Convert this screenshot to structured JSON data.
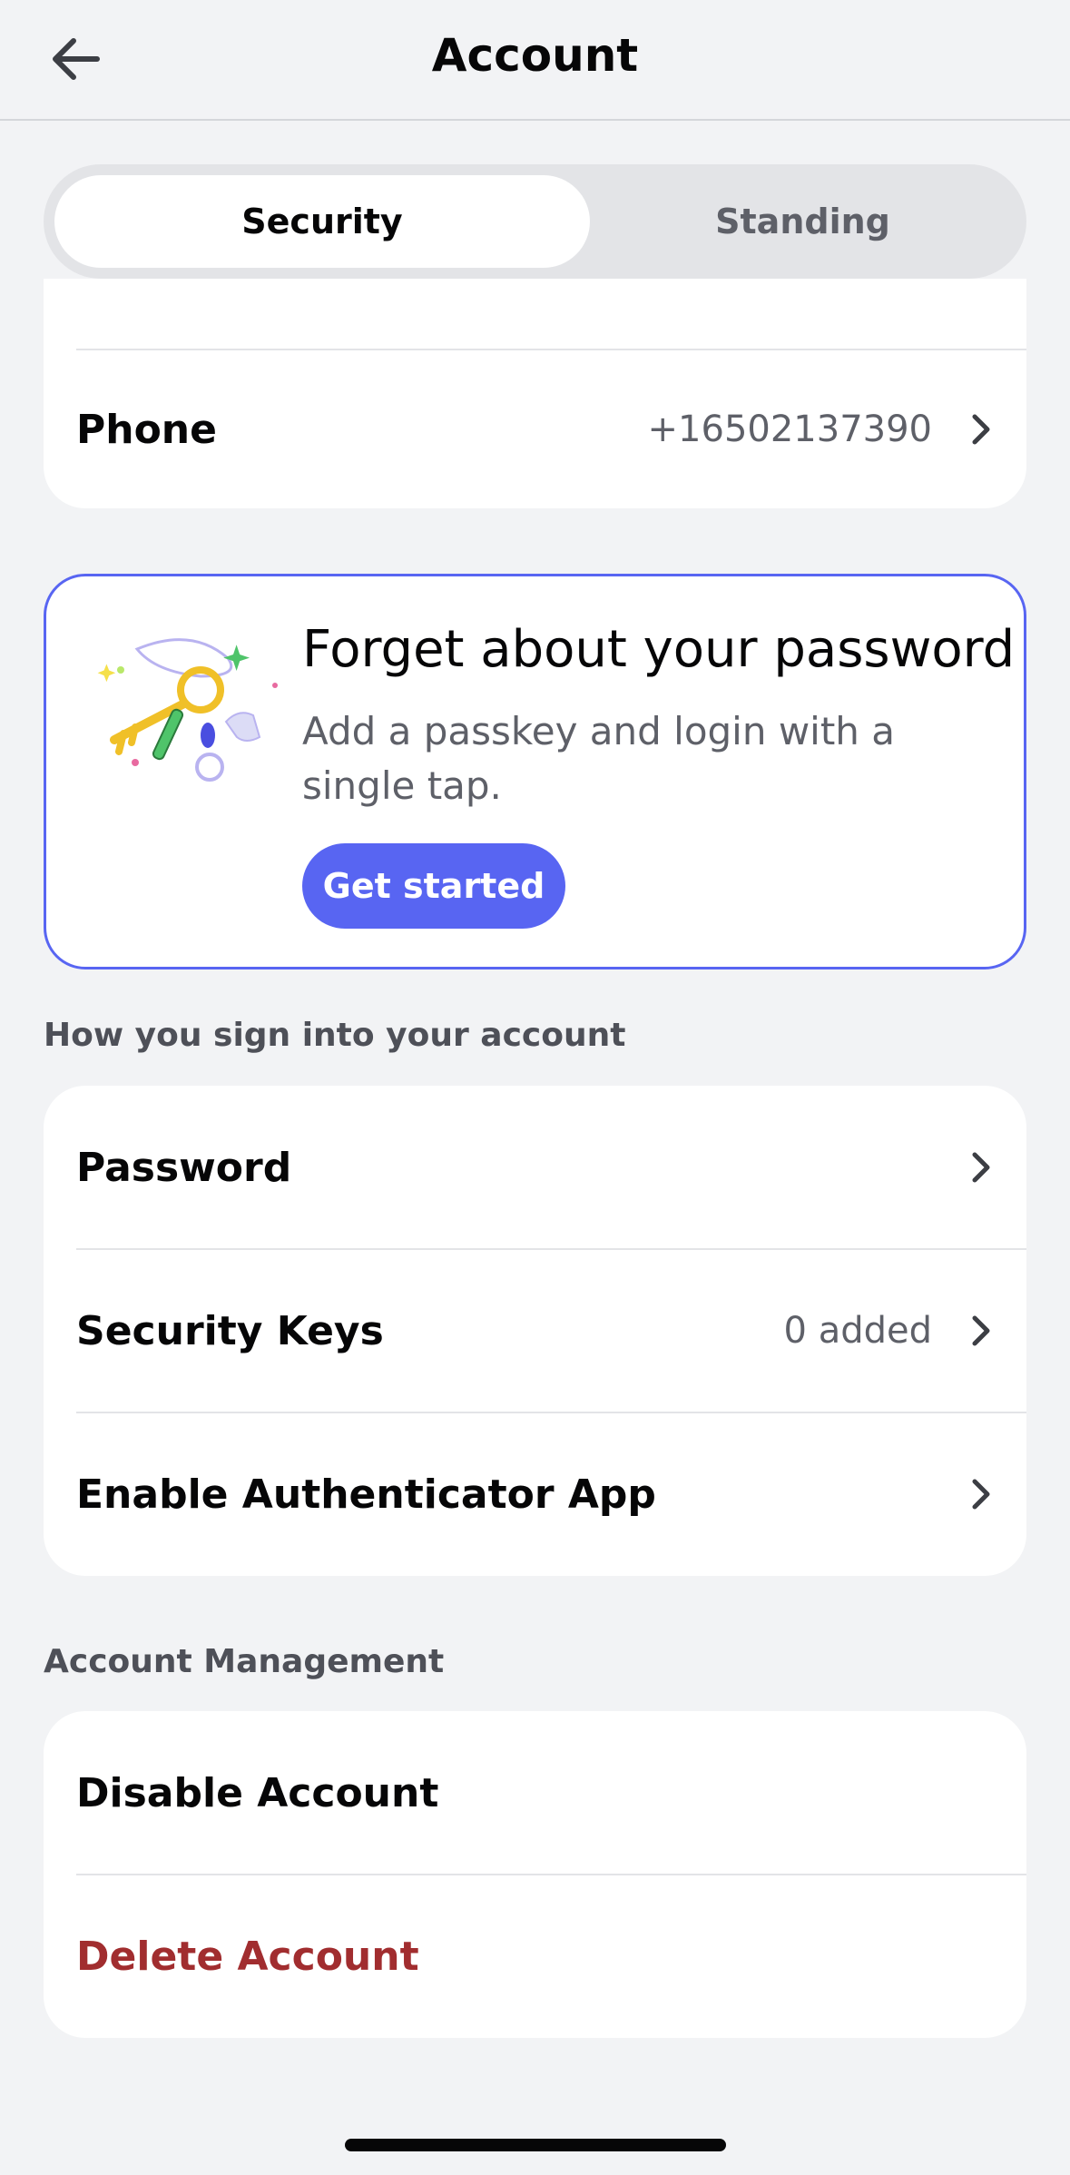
{
  "header": {
    "title": "Account"
  },
  "tabs": [
    {
      "label": "Security",
      "active": true
    },
    {
      "label": "Standing",
      "active": false
    }
  ],
  "top_card": {
    "partial_value": "",
    "phone": {
      "label": "Phone",
      "value": "+16502137390"
    }
  },
  "promo": {
    "title": "Forget about your password",
    "description": "Add a passkey and login with a single tap.",
    "button": "Get started"
  },
  "sign_in": {
    "section_label": "How you sign into your account",
    "items": [
      {
        "label": "Password",
        "value": ""
      },
      {
        "label": "Security Keys",
        "value": "0 added"
      },
      {
        "label": "Enable Authenticator App",
        "value": ""
      }
    ]
  },
  "management": {
    "section_label": "Account Management",
    "disable": "Disable Account",
    "delete": "Delete Account"
  },
  "colors": {
    "accent": "#5865f2",
    "danger": "#a12d2f",
    "background": "#f2f3f5",
    "card": "#ffffff"
  }
}
